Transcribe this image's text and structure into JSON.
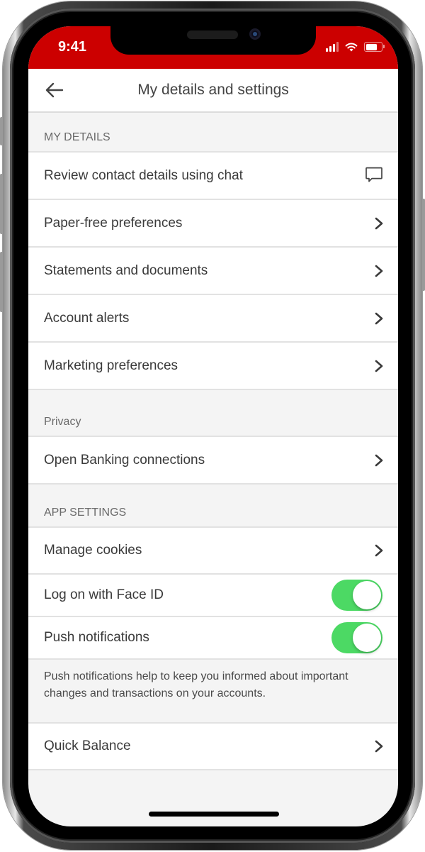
{
  "status_bar": {
    "time": "9:41",
    "icons": [
      "cellular-signal-icon",
      "wifi-icon",
      "battery-icon"
    ],
    "color": "#cc0000"
  },
  "nav": {
    "back_icon": "arrow-left-icon",
    "title": "My details and settings"
  },
  "sections": {
    "my_details": {
      "header": "MY DETAILS",
      "items": [
        {
          "label": "Review contact details using chat",
          "icon": "chat-bubble-icon"
        },
        {
          "label": "Paper-free preferences",
          "icon": "chevron-right-icon"
        },
        {
          "label": "Statements and documents",
          "icon": "chevron-right-icon"
        },
        {
          "label": "Account alerts",
          "icon": "chevron-right-icon"
        },
        {
          "label": "Marketing preferences",
          "icon": "chevron-right-icon"
        }
      ]
    },
    "privacy": {
      "header": "Privacy",
      "items": [
        {
          "label": "Open Banking connections",
          "icon": "chevron-right-icon"
        }
      ]
    },
    "app_settings": {
      "header": "APP SETTINGS",
      "items": [
        {
          "label": "Manage cookies",
          "icon": "chevron-right-icon"
        }
      ],
      "toggles": [
        {
          "label": "Log on with Face ID",
          "on": true
        },
        {
          "label": "Push notifications",
          "on": true
        }
      ],
      "footnote": "Push notifications help to keep you informed about important changes and transactions on your accounts.",
      "after_items": [
        {
          "label": "Quick Balance",
          "icon": "chevron-right-icon"
        }
      ]
    }
  },
  "colors": {
    "brand": "#cc0000",
    "toggle_on": "#4cd964",
    "text": "#3a3a3a",
    "section_bg": "#f4f4f4"
  }
}
